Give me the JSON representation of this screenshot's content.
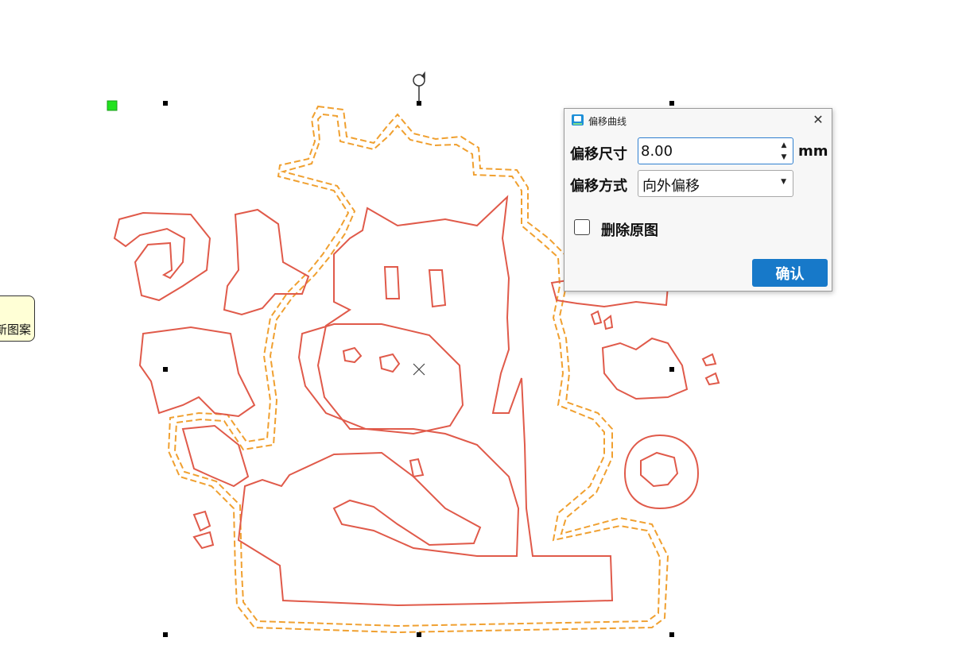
{
  "canvas": {
    "original_curve_color": "#e05a4a",
    "offset_curve_color": "#f0a030",
    "handle_color": "#000000",
    "anchor_color": "#21e21e"
  },
  "side_tooltip": {
    "text": "新图案"
  },
  "dialog": {
    "title": "偏移曲线",
    "offset_size_label": "偏移尺寸",
    "offset_size_value": "8.00",
    "unit": "mm",
    "offset_mode_label": "偏移方式",
    "offset_mode_value": "向外偏移",
    "delete_original_label": "删除原图",
    "delete_original_checked": false,
    "confirm_label": "确认",
    "confirm_color": "#1779c9"
  }
}
